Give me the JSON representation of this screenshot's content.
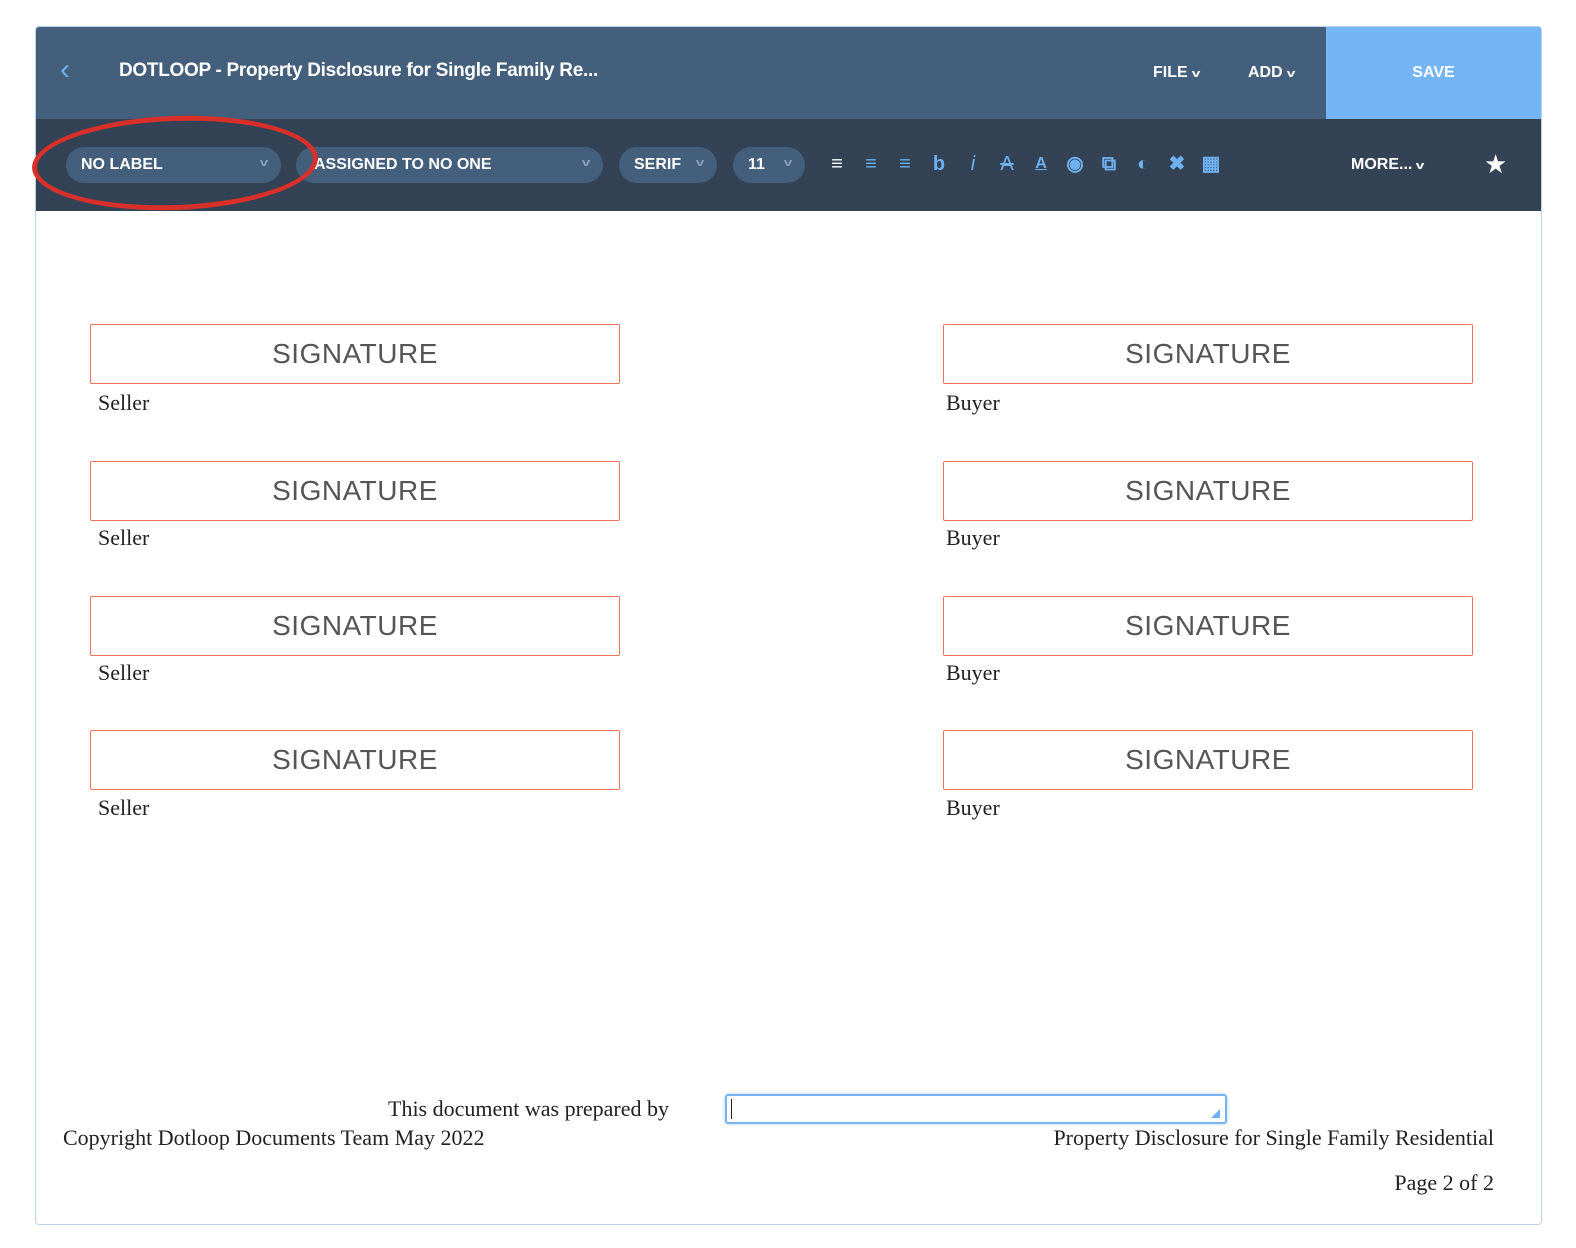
{
  "header": {
    "title": "DOTLOOP - Property Disclosure for Single Family Re...",
    "file": "FILE",
    "add": "ADD",
    "save": "SAVE"
  },
  "toolbar": {
    "label": "NO LABEL",
    "assigned": "ASSIGNED TO NO ONE",
    "font": "SERIF",
    "size": "11",
    "more": "MORE..."
  },
  "signatures": {
    "placeholder": "SIGNATURE",
    "left": [
      "Seller",
      "Seller",
      "Seller",
      "Seller"
    ],
    "right": [
      "Buyer",
      "Buyer",
      "Buyer",
      "Buyer"
    ]
  },
  "footer": {
    "prepared_by": "This document was prepared by",
    "prepared_value": "",
    "copyright": "Copyright Dotloop Documents Team May 2022",
    "doc_name": "Property Disclosure for Single Family Residential",
    "page": "Page 2 of 2"
  },
  "colors": {
    "header": "#445f7b",
    "toolbar": "#334355",
    "save": "#74b5f5",
    "signature_border": "#e9735f",
    "annotation": "#d9302a"
  }
}
